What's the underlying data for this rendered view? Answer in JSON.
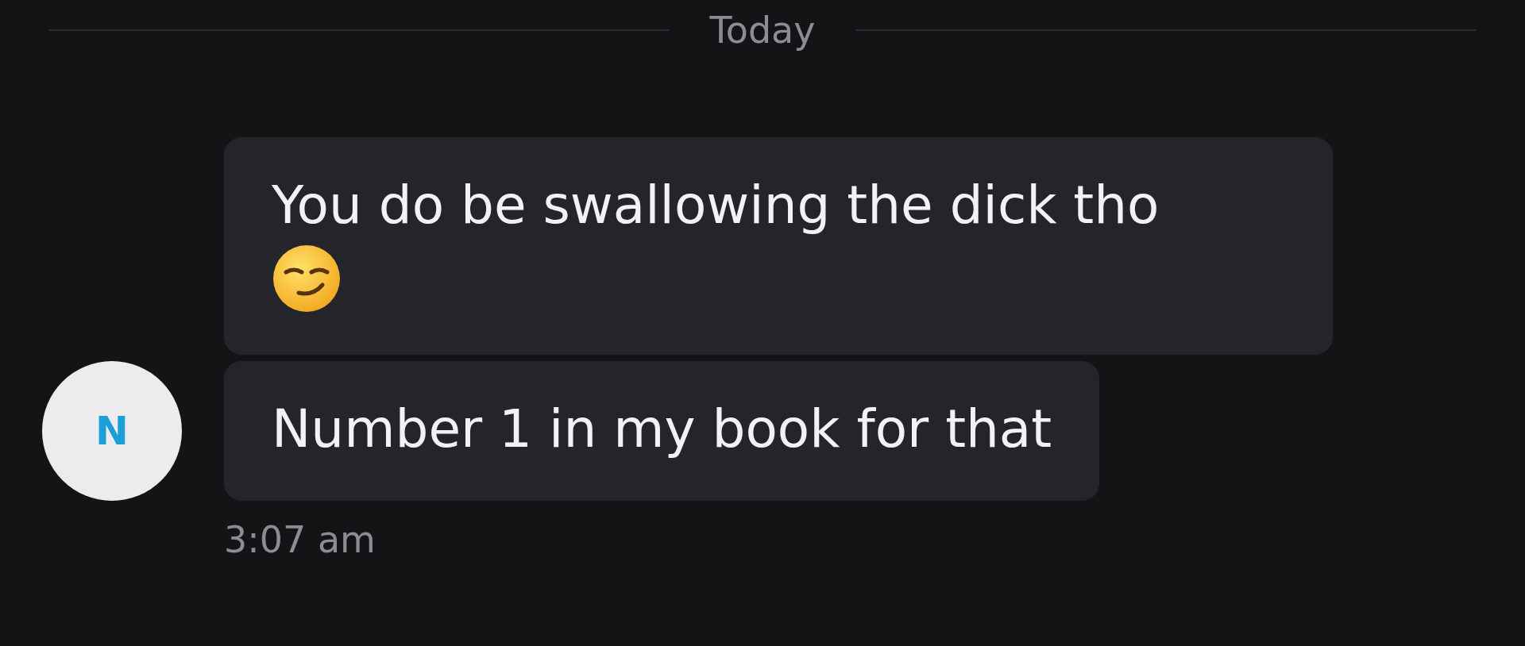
{
  "date_divider": "Today",
  "contact": {
    "initial": "N"
  },
  "messages": [
    {
      "kind": "smirk",
      "text": "You do be swallowing the dick tho"
    },
    {
      "kind": "plain",
      "text": "Number 1 in my book for that"
    }
  ],
  "timestamp": "3:07 am"
}
